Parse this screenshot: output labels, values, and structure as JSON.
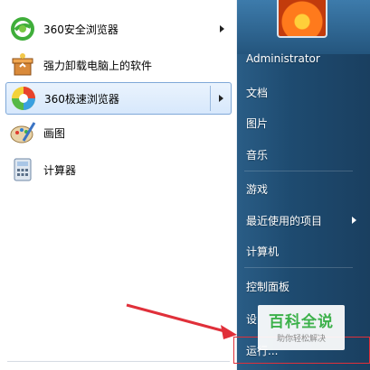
{
  "left_menu": {
    "items": [
      {
        "label": "360安全浏览器",
        "icon": "360-browser-green-icon",
        "has_arrow": true
      },
      {
        "label": "强力卸载电脑上的软件",
        "icon": "uninstall-box-icon",
        "has_arrow": false
      },
      {
        "label": "360极速浏览器",
        "icon": "360-speed-browser-icon",
        "has_arrow": true,
        "selected": true
      },
      {
        "label": "画图",
        "icon": "paint-palette-icon",
        "has_arrow": false
      },
      {
        "label": "计算器",
        "icon": "calculator-icon",
        "has_arrow": false
      }
    ]
  },
  "right_menu": {
    "items": [
      {
        "label": "Administrator"
      },
      {
        "label": "文档"
      },
      {
        "label": "图片"
      },
      {
        "label": "音乐"
      },
      {
        "label": "游戏"
      },
      {
        "label": "最近使用的项目",
        "has_arrow": true
      },
      {
        "label": "计算机"
      },
      {
        "label": "控制面板"
      },
      {
        "label": "设"
      },
      {
        "label": "运行..."
      }
    ]
  },
  "watermark": {
    "title": "百科全说",
    "subtitle": "助你轻松解决"
  },
  "colors": {
    "highlight_border": "#7fa8d8",
    "annotation_red": "#e0303a",
    "watermark_green": "#3cb14a"
  }
}
